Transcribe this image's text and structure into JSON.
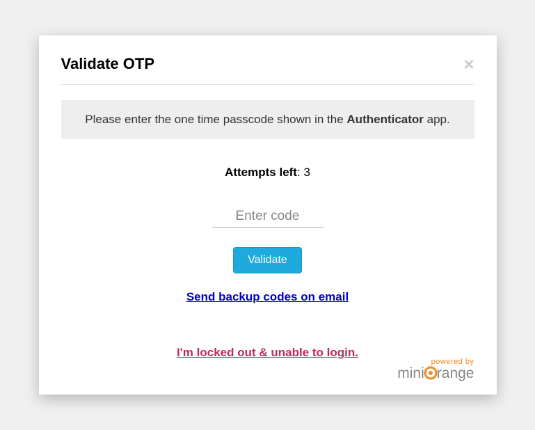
{
  "header": {
    "title": "Validate OTP"
  },
  "instruction": {
    "prefix": "Please enter the one time passcode shown in the ",
    "bold": "Authenticator",
    "suffix": " app."
  },
  "attempts": {
    "label": "Attempts left",
    "value": "3"
  },
  "input": {
    "placeholder": "Enter code"
  },
  "buttons": {
    "validate": "Validate"
  },
  "links": {
    "backup": "Send backup codes on email",
    "locked": "I'm locked out & unable to login."
  },
  "footer": {
    "powered": "powered by",
    "brand_prefix": "mini",
    "brand_suffix": "range"
  }
}
